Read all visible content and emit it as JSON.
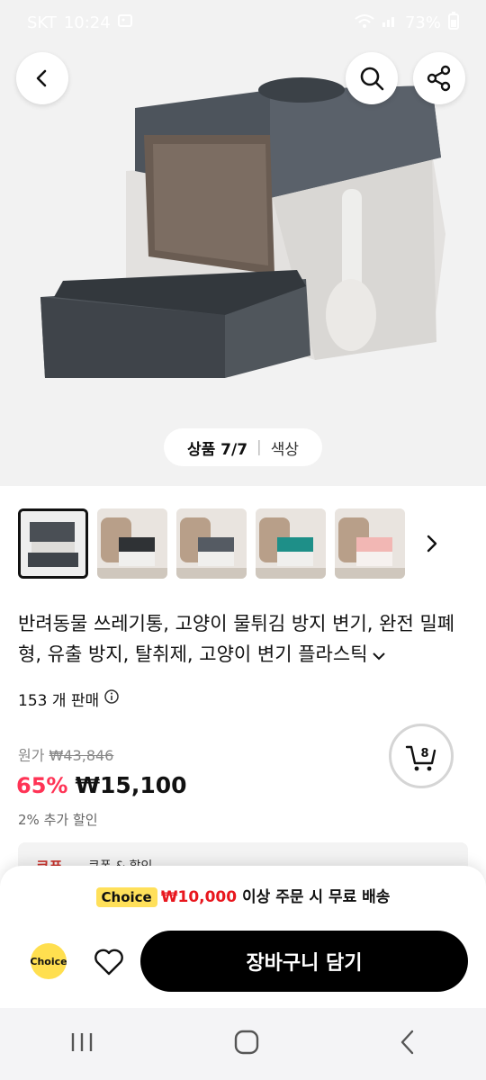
{
  "status": {
    "carrier": "SKT",
    "time": "10:24",
    "battery": "73%"
  },
  "hero": {
    "page_count": "상품 7/7",
    "color_label": "색상"
  },
  "thumbnails": [
    {
      "name": "thumb-1",
      "color": "#4a4f55"
    },
    {
      "name": "thumb-2",
      "color": "#2f3235"
    },
    {
      "name": "thumb-3",
      "color": "#555b63"
    },
    {
      "name": "thumb-4",
      "color": "#1e8f88"
    },
    {
      "name": "thumb-5",
      "color": "#f2b7b4"
    }
  ],
  "product": {
    "title": "반려동물 쓰레기통, 고양이 물튀김 방지 변기, 완전 밀폐형, 유출 방지, 탈취제, 고양이 변기 플라스틱",
    "sold": "153 개 판매",
    "original_label": "원가",
    "original_price": "₩43,846",
    "discount": "65%",
    "price": "₩15,100",
    "extra_discount": "2% 추가 할인",
    "cart_count": "8"
  },
  "coupon": {
    "label": "쿠폰",
    "text": "쿠폰 & 할인"
  },
  "bottom": {
    "promo_badge": "Choice",
    "promo_amount": "₩10,000",
    "promo_text": "이상 주문 시 무료 배송",
    "choice_logo": "Choice",
    "add_to_cart": "장바구니 담기"
  },
  "colors": {
    "accent_red": "#ff3355",
    "choice_yellow": "#ffdf4f"
  }
}
